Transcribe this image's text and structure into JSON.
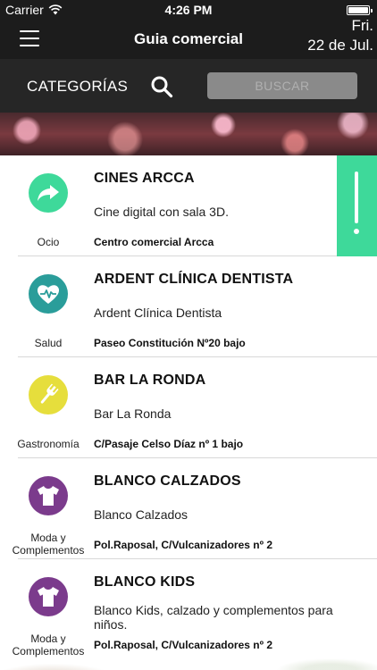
{
  "status_bar": {
    "carrier": "Carrier",
    "time": "4:26 PM"
  },
  "nav": {
    "title": "Guia comercial",
    "date_line1": "Fri.",
    "date_line2": "22 de Jul."
  },
  "search": {
    "categories_label": "CATEGORÍAS",
    "button_label": "BUSCAR"
  },
  "colors": {
    "ocio": "#3ed99a",
    "salud": "#2a9d9a",
    "gastronomia": "#e6de3c",
    "moda": "#7b3b8c",
    "swipe": "#3ed99a"
  },
  "items": [
    {
      "name": "CINES ARCCA",
      "description": "Cine digital con sala 3D.",
      "address": "Centro comercial Arcca",
      "category": "Ocio",
      "icon": "share-arrow-icon"
    },
    {
      "name": "ARDENT CLÍNICA DENTISTA",
      "description": "Ardent Clínica Dentista",
      "address": "Paseo Constitución Nº20 bajo",
      "category": "Salud",
      "icon": "heart-pulse-icon"
    },
    {
      "name": "BAR LA RONDA",
      "description": "Bar La Ronda",
      "address": "C/Pasaje Celso Díaz nº 1 bajo",
      "category": "Gastronomía",
      "icon": "fork-icon"
    },
    {
      "name": "BLANCO CALZADOS",
      "description": "Blanco Calzados",
      "address": "Pol.Raposal, C/Vulcanizadores nº 2",
      "category": "Moda y Complementos",
      "icon": "tshirt-icon"
    },
    {
      "name": "BLANCO KIDS",
      "description": "Blanco Kids, calzado y complementos para niños.",
      "address": "Pol.Raposal, C/Vulcanizadores nº 2",
      "category": "Moda y Complementos",
      "icon": "tshirt-icon"
    }
  ]
}
